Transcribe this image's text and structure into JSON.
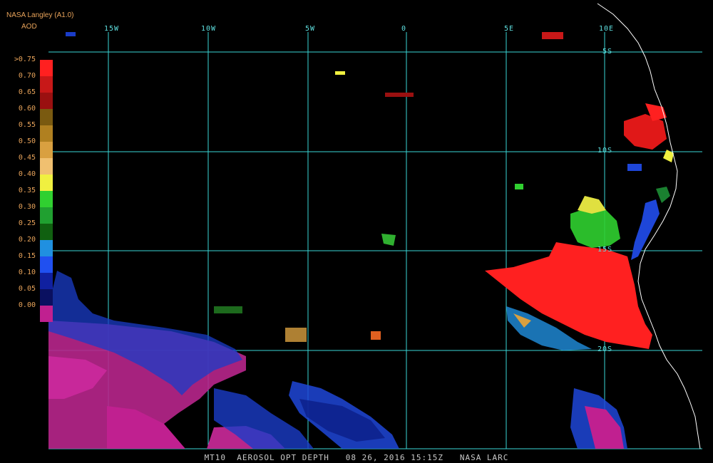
{
  "header": {
    "source": "NASA Langley (A1.0)",
    "product": "AOD"
  },
  "colors": {
    "grid": "#3ad6d6",
    "coast": "#ffffff",
    "label_orange": "#e8a35a"
  },
  "legend": {
    "labels": [
      ">0.75",
      "0.70",
      "0.65",
      "0.60",
      "0.55",
      "0.50",
      "0.45",
      "0.40",
      "0.35",
      "0.30",
      "0.25",
      "0.20",
      "0.15",
      "0.10",
      "0.05",
      "0.00"
    ],
    "colors": [
      "#ff2020",
      "#c81818",
      "#9a1010",
      "#7a5a10",
      "#b08020",
      "#d9a040",
      "#f0c070",
      "#f0f040",
      "#30d030",
      "#20a030",
      "#106010",
      "#2090e0",
      "#2050f0",
      "#1020a0",
      "#0a1060",
      "#c02090"
    ]
  },
  "grid": {
    "lon_labels": [
      "15W",
      "10W",
      "5W",
      "0",
      "5E",
      "10E"
    ],
    "lat_labels": [
      "5S",
      "10S",
      "15S",
      "20S"
    ]
  },
  "caption": "MT10  AEROSOL OPT DEPTH   08 26, 2016 15:15Z   NASA LARC"
}
